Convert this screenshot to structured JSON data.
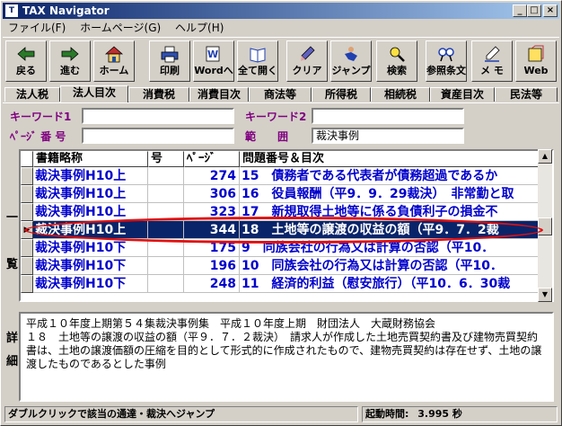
{
  "window": {
    "title": "TAX Navigator",
    "app_icon": "T"
  },
  "titlebar_buttons": {
    "min": "_",
    "max": "□",
    "close": "×"
  },
  "menu": [
    "ファイル(F)",
    "ホームページ(G)",
    "ヘルプ(H)"
  ],
  "toolbar": [
    {
      "label": "戻る",
      "icon": "back-arrow-icon"
    },
    {
      "label": "進む",
      "icon": "forward-arrow-icon"
    },
    {
      "label": "ホーム",
      "icon": "home-icon"
    },
    {
      "label": "印刷",
      "icon": "printer-icon"
    },
    {
      "label": "Wordへ",
      "icon": "word-icon"
    },
    {
      "label": "全て開く",
      "icon": "open-all-icon"
    },
    {
      "label": "クリア",
      "icon": "clear-icon"
    },
    {
      "label": "ジャンプ",
      "icon": "jump-icon"
    },
    {
      "label": "検索",
      "icon": "search-icon"
    },
    {
      "label": "参照条文",
      "icon": "reference-icon"
    },
    {
      "label": "メ モ",
      "icon": "memo-icon"
    },
    {
      "label": "Web",
      "icon": "web-icon"
    }
  ],
  "tabs": [
    "法人税",
    "法人目次",
    "消費税",
    "消費目次",
    "商法等",
    "所得税",
    "相続税",
    "資産目次",
    "民法等"
  ],
  "active_tab": "法人目次",
  "search": {
    "keyword1_label": "キーワード1",
    "keyword1_value": "",
    "keyword2_label": "キーワード2",
    "keyword2_value": "",
    "page_label": "ﾍﾟｰｼﾞ 番 号",
    "page_value": "",
    "scope_label": "範　　囲",
    "scope_value": "裁決事例"
  },
  "list_label": "一覧",
  "grid": {
    "columns": [
      "書籍略称",
      "号",
      "ﾍﾟｰｼﾞ",
      "問題番号＆目次"
    ],
    "rows": [
      {
        "book": "裁決事例H10上",
        "no": "",
        "page": "274",
        "item": "15　債務者である代表者が債務超過であるか"
      },
      {
        "book": "裁決事例H10上",
        "no": "",
        "page": "306",
        "item": "16　役員報酬（平9．9．29裁決）　非常勤と取"
      },
      {
        "book": "裁決事例H10上",
        "no": "",
        "page": "323",
        "item": "17　新規取得土地等に係る負債利子の損金不"
      },
      {
        "book": "裁決事例H10上",
        "no": "",
        "page": "344",
        "item": "18　土地等の譲渡の収益の額（平9．7．2裁"
      },
      {
        "book": "裁決事例H10下",
        "no": "",
        "page": "175",
        "item": "9　同族会社の行為又は計算の否認（平10．"
      },
      {
        "book": "裁決事例H10下",
        "no": "",
        "page": "196",
        "item": "10　同族会社の行為又は計算の否認（平10．"
      },
      {
        "book": "裁決事例H10下",
        "no": "",
        "page": "248",
        "item": "11　経済的利益（慰安旅行）（平10．6．30裁"
      }
    ],
    "selected_index": 3
  },
  "detail_label": "詳細",
  "detail_text": "平成１０年度上期第５４集裁決事例集　平成１０年度上期　財団法人　大蔵財務協会\n１８　土地等の譲渡の収益の額（平９．７．２裁決）　請求人が作成した土地売買契約書及び建物売買契約書は、土地の譲渡価額の圧縮を目的として形式的に作成されたもので、建物売買契約は存在せず、土地の譲渡したものであるとした事例",
  "status": {
    "hint": "ダブルクリックで該当の通達・裁決へジャンプ",
    "startup_label": "起動時間:",
    "startup_value": "3.995 秒"
  },
  "colors": {
    "accent": "#0a246a",
    "link": "#0000cc",
    "label": "#800080",
    "ring": "#e01010"
  }
}
